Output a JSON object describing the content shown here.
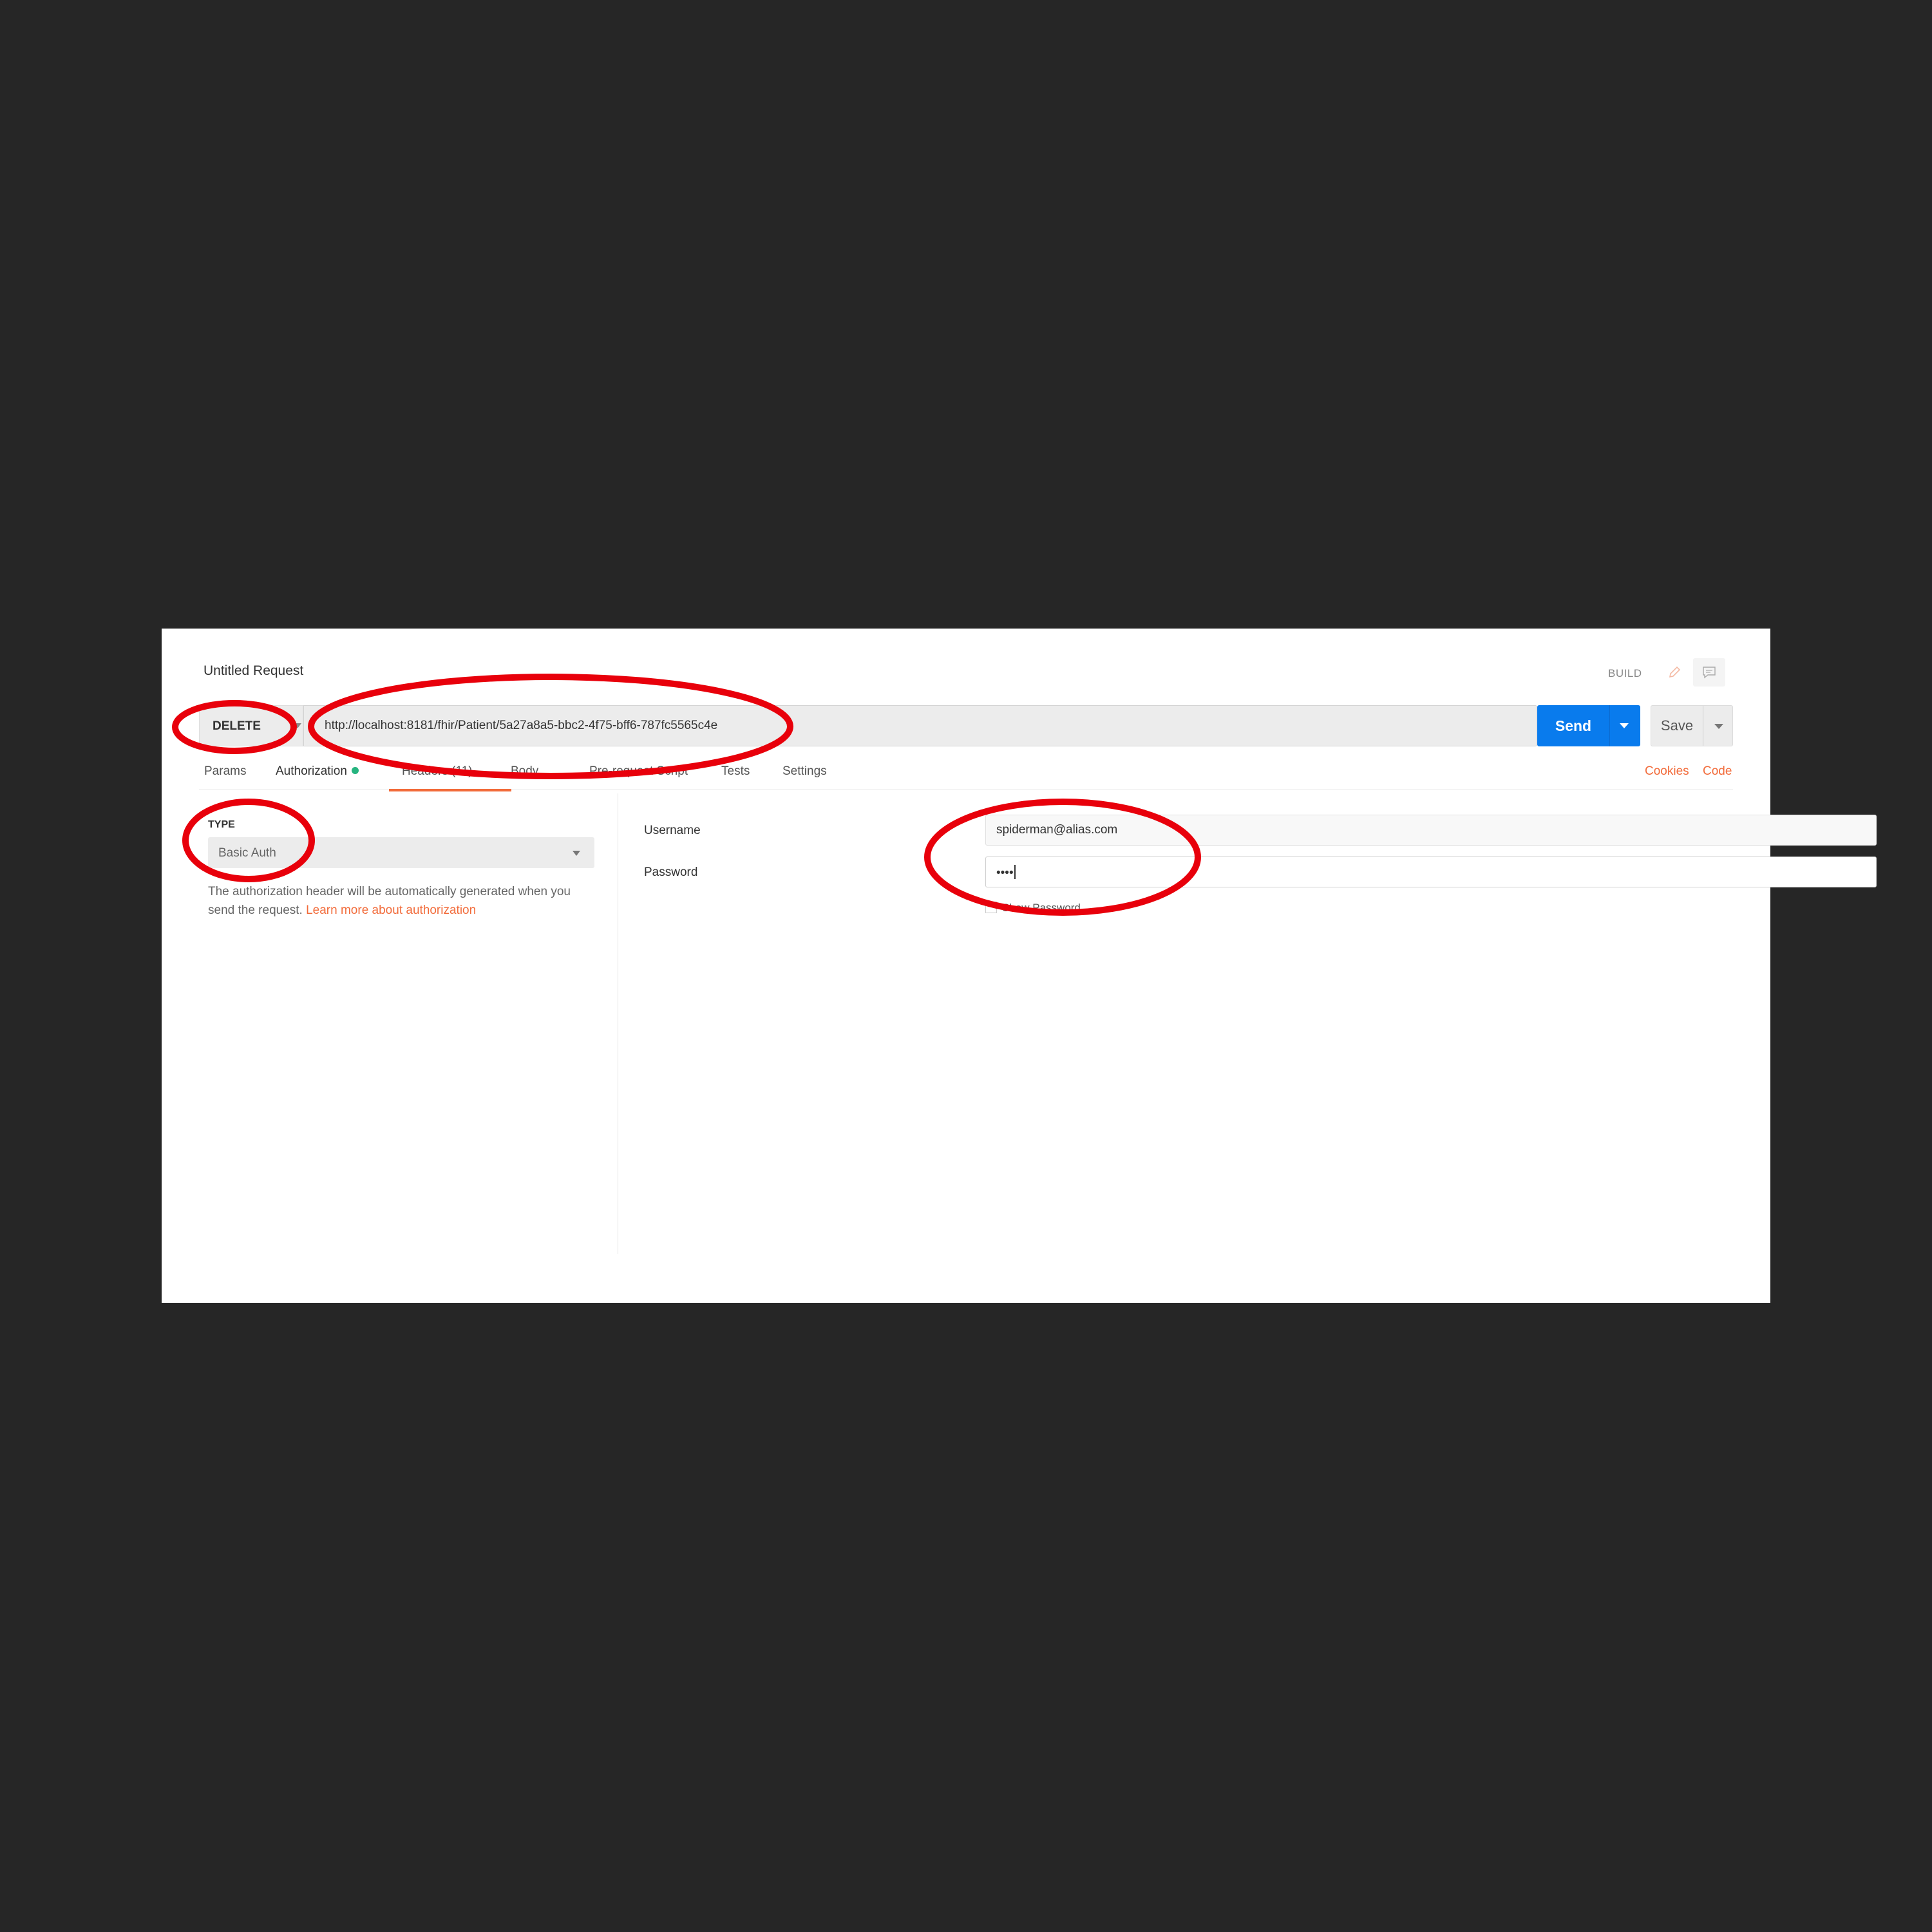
{
  "request": {
    "title": "Untitled Request",
    "mode_label": "BUILD",
    "method": "DELETE",
    "url": "http://localhost:8181/fhir/Patient/5a27a8a5-bbc2-4f75-bff6-787fc5565c4e",
    "send_label": "Send",
    "save_label": "Save"
  },
  "tabs": [
    {
      "label": "Params"
    },
    {
      "label": "Authorization",
      "active": true
    },
    {
      "label": "Headers (11)"
    },
    {
      "label": "Body"
    },
    {
      "label": "Pre-request Script"
    },
    {
      "label": "Tests"
    },
    {
      "label": "Settings"
    }
  ],
  "links": {
    "cookies": "Cookies",
    "code": "Code"
  },
  "auth": {
    "type_label": "TYPE",
    "type_value": "Basic Auth",
    "help_text": "The authorization header will be automatically generated when you send the request.",
    "help_link": "Learn more about authorization",
    "username_label": "Username",
    "username_value": "spiderman@alias.com",
    "password_label": "Password",
    "password_value": "••••",
    "show_password_label": "Show Password"
  },
  "colors": {
    "accent": "#f26b3a",
    "send": "#097bed",
    "annotation": "#e8000b",
    "status_dot": "#26b47f"
  }
}
